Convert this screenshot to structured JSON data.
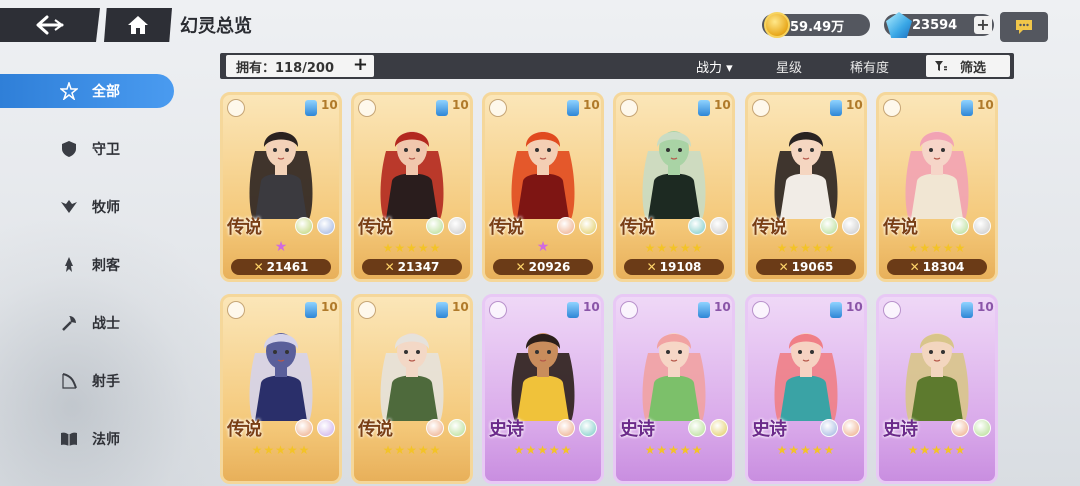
{
  "header": {
    "title": "幻灵总览",
    "gold": "59.49万",
    "gems": "23594"
  },
  "filter_bar": {
    "owned_label": "拥有：118/200",
    "sort_power": "战力 ▾",
    "sort_star": "星级",
    "sort_rarity": "稀有度",
    "filter_label": "筛选"
  },
  "sidebar": {
    "items": [
      {
        "label": "全部",
        "icon": "star-outline-icon",
        "active": true
      },
      {
        "label": "守卫",
        "icon": "shield-icon",
        "active": false
      },
      {
        "label": "牧师",
        "icon": "wings-icon",
        "active": false
      },
      {
        "label": "刺客",
        "icon": "dagger-icon",
        "active": false
      },
      {
        "label": "战士",
        "icon": "axe-icon",
        "active": false
      },
      {
        "label": "射手",
        "icon": "bow-icon",
        "active": false
      },
      {
        "label": "法师",
        "icon": "book-icon",
        "active": false
      }
    ]
  },
  "cards": [
    {
      "rarity": "传说",
      "level": "10",
      "power": "21461",
      "tier": "legend",
      "stars": "★",
      "pink": true,
      "hair": "#2b2220",
      "skin": "#f3d2b8",
      "outfit": "#3b3a3f",
      "elems": [
        "#cfe09a",
        "#b9c8e8"
      ]
    },
    {
      "rarity": "传说",
      "level": "10",
      "power": "21347",
      "tier": "legend",
      "stars": "★★★★★",
      "pink": false,
      "hair": "#b3281f",
      "skin": "#f1c7ad",
      "outfit": "#2a1d1d",
      "elems": [
        "#c9e6b0",
        "#d8d8d8"
      ]
    },
    {
      "rarity": "传说",
      "level": "10",
      "power": "20926",
      "tier": "legend",
      "stars": "★",
      "pink": true,
      "hair": "#e14a1f",
      "skin": "#f4cfb4",
      "outfit": "#7e1513",
      "elems": [
        "#f2c2a8",
        "#e9d98c"
      ]
    },
    {
      "rarity": "传说",
      "level": "10",
      "power": "19108",
      "tier": "legend",
      "stars": "★★★★★",
      "pink": false,
      "hair": "#c9dcc4",
      "skin": "#a9d3a5",
      "outfit": "#1d2a22",
      "elems": [
        "#9fd9d6",
        "#d8d8d8"
      ]
    },
    {
      "rarity": "传说",
      "level": "10",
      "power": "19065",
      "tier": "legend",
      "stars": "★★★★★",
      "pink": false,
      "hair": "#2a2322",
      "skin": "#f5d6c1",
      "outfit": "#f1ece6",
      "elems": [
        "#c9e6b0",
        "#d8d8d8"
      ]
    },
    {
      "rarity": "传说",
      "level": "10",
      "power": "18304",
      "tier": "legend",
      "stars": "★★★★★",
      "pink": false,
      "hair": "#f2a3b4",
      "skin": "#f6d5c8",
      "outfit": "#f1e6d3",
      "elems": [
        "#c9e6b0",
        "#d8d8d8"
      ]
    },
    {
      "rarity": "传说",
      "level": "10",
      "power": "",
      "tier": "legend",
      "stars": "★★★★★",
      "pink": false,
      "hair": "#d5d3ea",
      "skin": "#5a5f9a",
      "outfit": "#2a2f6a",
      "elems": [
        "#f2c2a8",
        "#d9c4ef"
      ]
    },
    {
      "rarity": "传说",
      "level": "10",
      "power": "",
      "tier": "legend",
      "stars": "★★★★★",
      "pink": false,
      "hair": "#e6e2dc",
      "skin": "#f3d8c6",
      "outfit": "#4e6a3c",
      "elems": [
        "#f2c2a8",
        "#c9e6b0"
      ]
    },
    {
      "rarity": "史诗",
      "level": "10",
      "power": "",
      "tier": "epic",
      "stars": "★★★★★",
      "pink": false,
      "hair": "#2b1f1a",
      "skin": "#c98d5c",
      "outfit": "#f0c23a",
      "elems": [
        "#f2c2a8",
        "#9fd9d6"
      ]
    },
    {
      "rarity": "史诗",
      "level": "10",
      "power": "",
      "tier": "epic",
      "stars": "★★★★★",
      "pink": false,
      "hair": "#f1a2a2",
      "skin": "#f6d6c6",
      "outfit": "#7cc06a",
      "elems": [
        "#c9e6b0",
        "#e9d98c"
      ]
    },
    {
      "rarity": "史诗",
      "level": "10",
      "power": "",
      "tier": "epic",
      "stars": "★★★★★",
      "pink": false,
      "hair": "#f07f86",
      "skin": "#f6d2c2",
      "outfit": "#3aa3a5",
      "elems": [
        "#b9c8e8",
        "#f2c2a8"
      ]
    },
    {
      "rarity": "史诗",
      "level": "10",
      "power": "",
      "tier": "epic",
      "stars": "★★★★★",
      "pink": false,
      "hair": "#d8c58a",
      "skin": "#f3d6bf",
      "outfit": "#5d7a2e",
      "elems": [
        "#f2c2a8",
        "#c9e6b0"
      ]
    }
  ]
}
